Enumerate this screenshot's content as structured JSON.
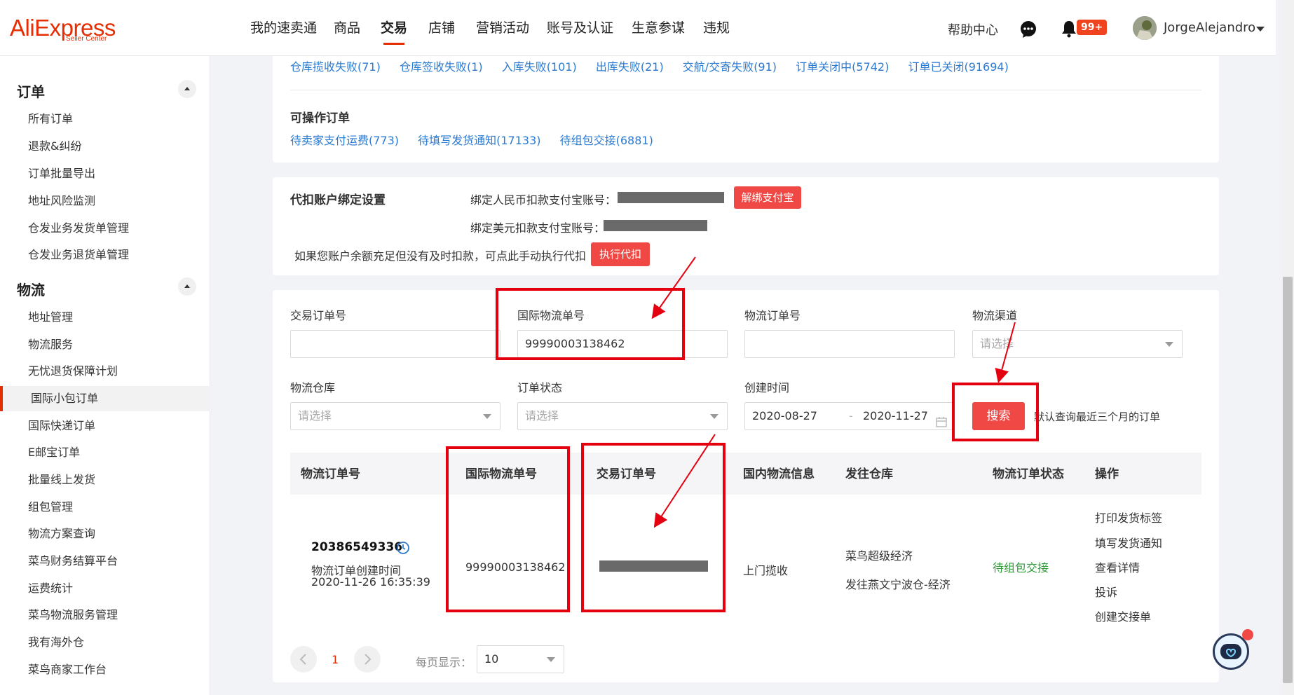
{
  "brand": {
    "name": "AliExpress",
    "sub": "Seller Center",
    "color": "#e62e04"
  },
  "nav": {
    "items": [
      "我的速卖通",
      "商品",
      "交易",
      "店铺",
      "营销活动",
      "账号及认证",
      "生意参谋",
      "违规"
    ],
    "active": "交易",
    "help": "帮助中心",
    "notifications_badge": "99+",
    "username": "JorgeAlejandro"
  },
  "sidebar": {
    "order_section": "订单",
    "order_items": [
      "所有订单",
      "退款&纠纷",
      "订单批量导出",
      "地址风险监测",
      "仓发业务发货单管理",
      "仓发业务退货单管理"
    ],
    "logistics_section": "物流",
    "logistics_items": [
      "地址管理",
      "物流服务",
      "无忧退货保障计划",
      "国际小包订单",
      "国际快递订单",
      "E邮宝订单",
      "批量线上发货",
      "组包管理",
      "物流方案查询",
      "菜鸟财务结算平台",
      "运费统计",
      "菜鸟物流服务管理",
      "我有海外仓",
      "菜鸟商家工作台"
    ],
    "active_item": "国际小包订单"
  },
  "status_links": {
    "row1": [
      "仓库揽收失败(71)",
      "仓库签收失败(1)",
      "入库失败(101)",
      "出库失败(21)",
      "交航/交寄失败(91)",
      "订单关闭中(5742)",
      "订单已关闭(91694)"
    ],
    "operable_title": "可操作订单",
    "operable": [
      "待卖家支付运费(773)",
      "待填写发货通知(17133)",
      "待组包交接(6881)"
    ]
  },
  "binding": {
    "title": "代扣账户绑定设置",
    "cny_label": "绑定人民币扣款支付宝账号：",
    "unbind_button": "解绑支付宝",
    "usd_label": "绑定美元扣款支付宝账号：",
    "notice": "如果您账户余额充足但没有及时扣款，可点此手动执行代扣",
    "execute_button": "执行代扣"
  },
  "filters": {
    "trade_order_label": "交易订单号",
    "trade_order_value": "",
    "intl_tracking_label": "国际物流单号",
    "intl_tracking_value": "99990003138462",
    "logistics_order_label": "物流订单号",
    "logistics_order_value": "",
    "channel_label": "物流渠道",
    "channel_placeholder": "请选择",
    "warehouse_label": "物流仓库",
    "warehouse_placeholder": "请选择",
    "status_label": "订单状态",
    "status_placeholder": "请选择",
    "created_label": "创建时间",
    "date_from": "2020-08-27",
    "date_sep": "-",
    "date_to": "2020-11-27",
    "search_button": "搜索",
    "search_hint": "默认查询最近三个月的订单"
  },
  "table": {
    "headers": [
      "物流订单号",
      "国际物流单号",
      "交易订单号",
      "国内物流信息",
      "发往仓库",
      "物流订单状态",
      "操作"
    ],
    "rows": [
      {
        "logistics_order_no": "20386549336",
        "created_label": "物流订单创建时间",
        "created_time": "2020-11-26 16:35:39",
        "intl_tracking_no": "99990003138462",
        "domestic_info": "上门揽收",
        "warehouse_line1": "菜鸟超级经济",
        "warehouse_line2": "发往燕文宁波仓-经济",
        "status": "待组包交接",
        "actions": [
          "打印发货标签",
          "填写发货通知",
          "查看详情",
          "投诉",
          "创建交接单"
        ]
      }
    ]
  },
  "pagination": {
    "current_page": "1",
    "page_size_label": "每页显示：",
    "page_size": "10"
  },
  "colors": {
    "accent_red": "#e62e04",
    "button_red": "#f04844",
    "link_blue": "#2b7ad0",
    "status_green": "#2e9a3a",
    "annotation_red": "#e4000f"
  }
}
